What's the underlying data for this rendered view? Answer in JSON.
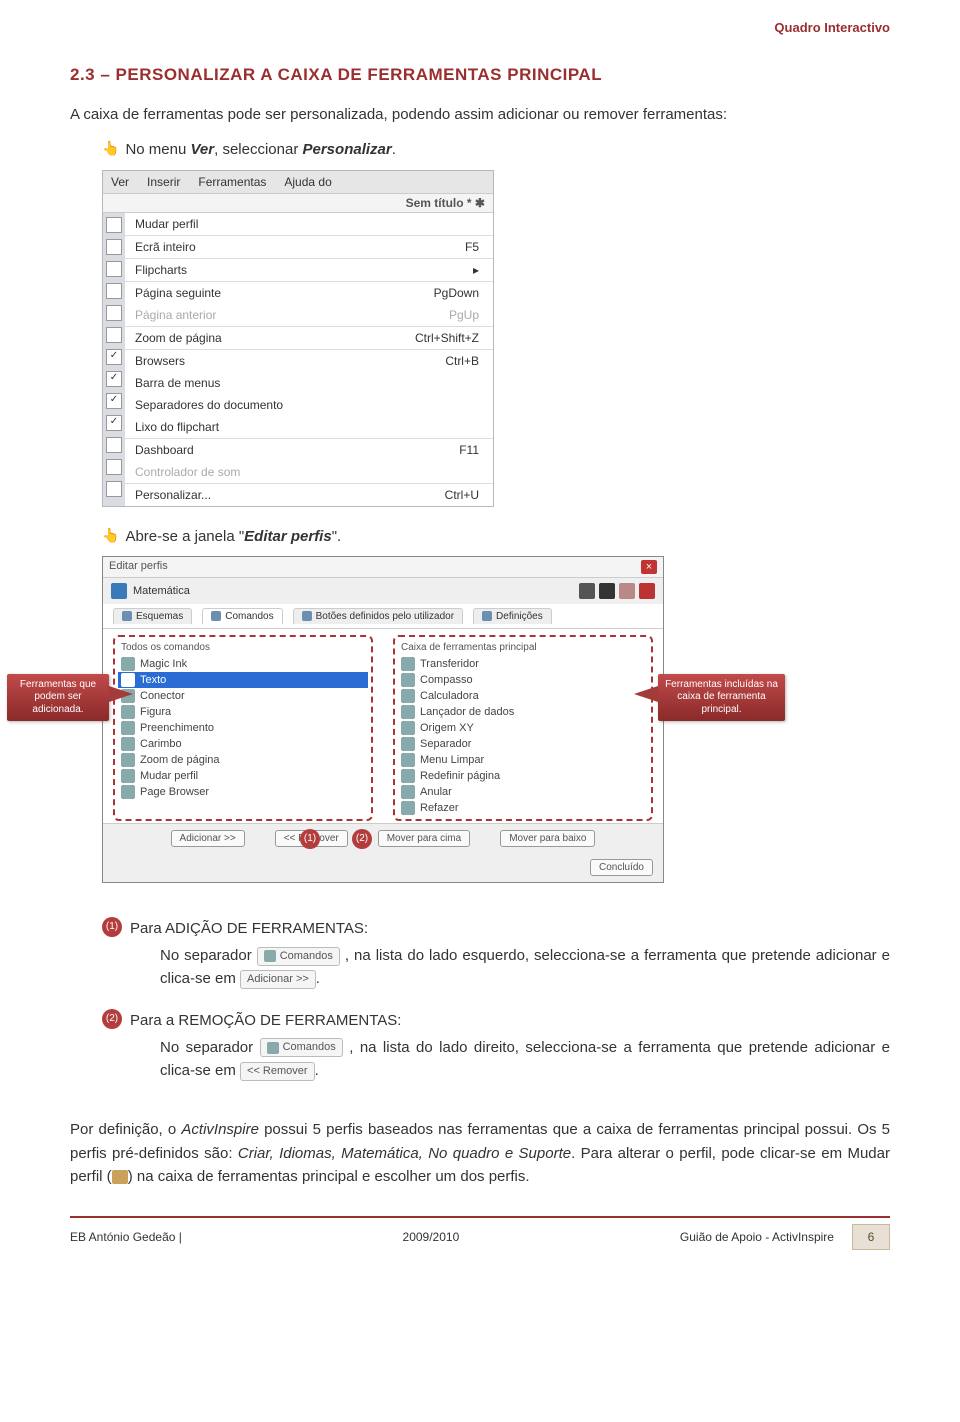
{
  "header": {
    "corner": "Quadro Interactivo"
  },
  "section": {
    "title": "2.3 – PERSONALIZAR A CAIXA DE FERRAMENTAS PRINCIPAL",
    "intro": "A caixa de ferramentas pode ser personalizada, podendo assim adicionar ou remover ferramentas:",
    "bullet1_pre": "No menu ",
    "bullet1_ver": "Ver",
    "bullet1_mid": ", seleccionar ",
    "bullet1_personalizar": "Personalizar",
    "bullet1_end": ".",
    "bullet2_pre": "Abre-se a janela \"",
    "bullet2_title": "Editar perfis",
    "bullet2_end": "\"."
  },
  "menu": {
    "bar": [
      "Ver",
      "Inserir",
      "Ferramentas",
      "Ajuda do"
    ],
    "titlebar": "Sem título * ✱",
    "items": [
      {
        "label": "Mudar perfil",
        "sc": "",
        "dim": false
      },
      {
        "label": "Ecrã inteiro",
        "sc": "F5",
        "dim": false
      },
      {
        "label": "Flipcharts",
        "sc": "▸",
        "dim": false
      },
      {
        "label": "Página seguinte",
        "sc": "PgDown",
        "dim": false
      },
      {
        "label": "Página anterior",
        "sc": "PgUp",
        "dim": true
      },
      {
        "label": "Zoom de página",
        "sc": "Ctrl+Shift+Z",
        "dim": false
      },
      {
        "label": "Browsers",
        "sc": "Ctrl+B",
        "dim": false
      },
      {
        "label": "Barra de menus",
        "sc": "",
        "dim": false
      },
      {
        "label": "Separadores do documento",
        "sc": "",
        "dim": false
      },
      {
        "label": "Lixo do flipchart",
        "sc": "",
        "dim": false
      },
      {
        "label": "Dashboard",
        "sc": "F11",
        "dim": false
      },
      {
        "label": "Controlador de som",
        "sc": "",
        "dim": true
      },
      {
        "label": "Personalizar...",
        "sc": "Ctrl+U",
        "dim": false
      }
    ]
  },
  "dialog": {
    "title": "Editar perfis",
    "profile": "Matemática",
    "tabs": [
      "Esquemas",
      "Comandos",
      "Botões definidos pelo utilizador",
      "Definições"
    ],
    "left_header": "Todos os comandos",
    "right_header": "Caixa de ferramentas principal",
    "left_items": [
      "Magic Ink",
      "Texto",
      "Conector",
      "Figura",
      "Preenchimento",
      "Carimbo",
      "Zoom de página",
      "Mudar perfil",
      "Page Browser"
    ],
    "right_items": [
      "Transferidor",
      "Compasso",
      "Calculadora",
      "Lançador de dados",
      "Origem XY",
      "Separador",
      "Menu Limpar",
      "Redefinir página",
      "Anular",
      "Refazer"
    ],
    "btn_add": "Adicionar >>",
    "btn_remove": "<< Remover",
    "btn_up": "Mover para cima",
    "btn_down": "Mover para baixo",
    "btn_done": "Concluído",
    "callout_left": "Ferramentas que podem ser adicionada.",
    "callout_right": "Ferramentas incluídas na caixa de ferramenta principal.",
    "badge1": "(1)",
    "badge2": "(2)"
  },
  "steps": {
    "b1": "(1)",
    "b2": "(2)",
    "t1_title": "Para ADIÇÃO DE FERRAMENTAS:",
    "t1_line_a": "No separador ",
    "t1_line_b": ", na lista do lado esquerdo, selecciona-se a ferramenta que pretende adicionar e clica-se em ",
    "t1_end": ".",
    "chip_comandos": "Comandos",
    "chip_add": "Adicionar >>",
    "t2_title": "Para a REMOÇÃO DE FERRAMENTAS:",
    "t2_line_a": "No separador ",
    "t2_line_b": ", na lista do lado direito, selecciona-se a ferramenta que pretende adicionar e clica-se em ",
    "chip_remove": "<< Remover",
    "t2_end": "."
  },
  "closing": {
    "p1a": "Por definição, o ",
    "p1b": "ActivInspire",
    "p1c": " possui 5 perfis baseados nas ferramentas que a caixa de ferramentas principal possui. Os 5 perfis pré-definidos são: ",
    "profiles": "Criar, Idiomas, Matemática, No quadro e Suporte",
    "p1d": ". Para alterar o perfil, pode clicar-se em  Mudar perfil (",
    "p1e": ") na caixa de ferramentas principal e escolher um dos perfis."
  },
  "footer": {
    "left": "EB António Gedeão |",
    "center": "2009/2010",
    "right": "Guião de Apoio -  ActivInspire",
    "page": "6"
  }
}
